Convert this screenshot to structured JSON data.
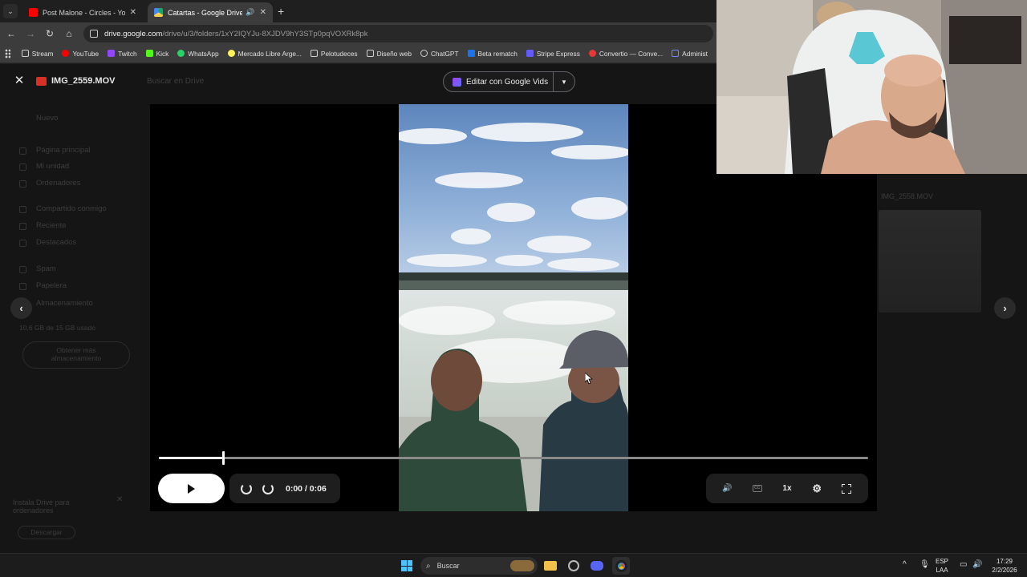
{
  "browser": {
    "tabs": [
      {
        "title": "Post Malone - Circles - YouTube",
        "active": false
      },
      {
        "title": "Catartas - Google Drive",
        "active": true
      }
    ],
    "url_host": "drive.google.com",
    "url_path": "/drive/u/3/folders/1xY2IQYJu-8XJDV9hY3STp0pqVOXRk8pk",
    "bookmarks": [
      "Stream",
      "YouTube",
      "Twitch",
      "Kick",
      "WhatsApp",
      "Mercado Libre Arge...",
      "Pelotudeces",
      "Diseño web",
      "ChatGPT",
      "Beta rematch",
      "Stripe Express",
      "Convertio — Conve...",
      "Administ"
    ]
  },
  "drive_background": {
    "new_button": "Nuevo",
    "sidebar": [
      "Página principal",
      "Mi unidad",
      "Ordenadores",
      "Compartido conmigo",
      "Reciente",
      "Destacados",
      "Spam",
      "Papelera",
      "Almacenamiento"
    ],
    "storage_text": "10,6 GB de 15 GB usado",
    "storage_button": "Obtener más almacenamiento",
    "promo_text": "Instala Drive para ordenadores",
    "promo_button": "Descargar",
    "search_placeholder": "Buscar en Drive",
    "right_file_name": "IMG_2558.MOV"
  },
  "viewer": {
    "file_name": "IMG_2559.MOV",
    "edit_button": "Editar con Google Vids",
    "time_display": "0:00 / 0:06",
    "speed": "1x",
    "progress_fraction": 0.09
  },
  "taskbar": {
    "search_placeholder": "Buscar",
    "lang_line1": "ESP",
    "lang_line2": "LAA",
    "time": "17:29",
    "date": "2/2/2026"
  }
}
